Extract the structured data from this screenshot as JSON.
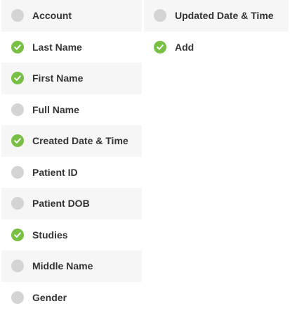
{
  "colors": {
    "checked": "#77c043",
    "unchecked": "#d4d4d4",
    "row_shade": "#f6f6f6",
    "text": "#333333"
  },
  "icons": {
    "checked": "check-circle-icon",
    "unchecked": "empty-circle-icon"
  },
  "columns": [
    {
      "items": [
        {
          "label": "Account",
          "checked": false
        },
        {
          "label": "Last Name",
          "checked": true
        },
        {
          "label": "First Name",
          "checked": true
        },
        {
          "label": "Full Name",
          "checked": false
        },
        {
          "label": "Created Date & Time",
          "checked": true
        },
        {
          "label": "Patient ID",
          "checked": false
        },
        {
          "label": "Patient DOB",
          "checked": false
        },
        {
          "label": "Studies",
          "checked": true
        },
        {
          "label": "Middle Name",
          "checked": false
        },
        {
          "label": "Gender",
          "checked": false
        }
      ]
    },
    {
      "items": [
        {
          "label": "Updated Date & Time",
          "checked": false
        },
        {
          "label": "Add",
          "checked": true
        }
      ]
    }
  ]
}
